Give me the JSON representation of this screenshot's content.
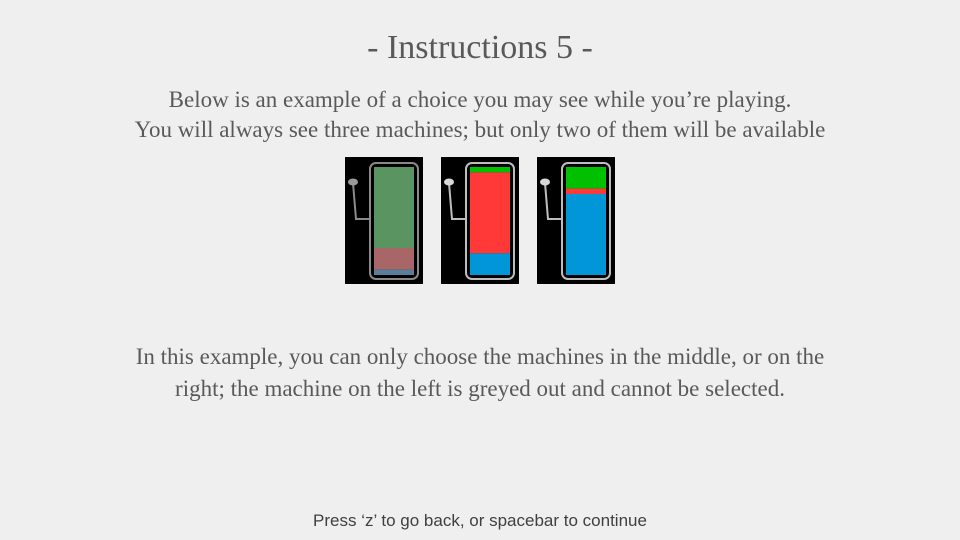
{
  "title": "- Instructions 5 -",
  "intro": {
    "line1": "Below is an example of a choice you may see while you’re playing.",
    "line2": "You will always see three machines; but only two of them will be available"
  },
  "machines": [
    {
      "position": "left",
      "available": false,
      "segments": [
        {
          "color": "#5a9460",
          "fraction": 0.75
        },
        {
          "color": "#a86666",
          "fraction": 0.2
        },
        {
          "color": "#5a7f9a",
          "fraction": 0.05
        }
      ]
    },
    {
      "position": "middle",
      "available": true,
      "segments": [
        {
          "color": "#00c000",
          "fraction": 0.05
        },
        {
          "color": "#ff3838",
          "fraction": 0.75
        },
        {
          "color": "#0096d8",
          "fraction": 0.2
        }
      ]
    },
    {
      "position": "right",
      "available": true,
      "segments": [
        {
          "color": "#00c000",
          "fraction": 0.2
        },
        {
          "color": "#ff3838",
          "fraction": 0.05
        },
        {
          "color": "#0096d8",
          "fraction": 0.75
        }
      ]
    }
  ],
  "explanation": {
    "line1": "In this example, you can only choose the machines in the middle, or on the",
    "line2": "right; the machine on the left is greyed out and cannot be selected."
  },
  "footer": "Press ‘z’ to go back, or spacebar to continue"
}
